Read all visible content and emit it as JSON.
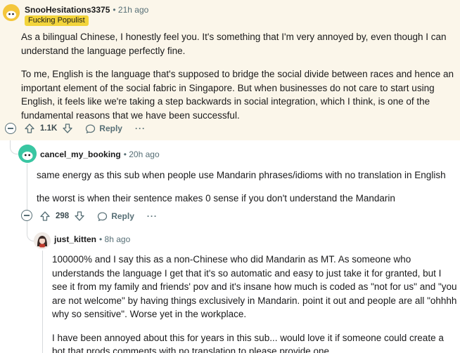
{
  "comments": [
    {
      "username": "SnooHesitations3375",
      "time": "• 21h ago",
      "flair": "Fucking Populist",
      "paragraphs": [
        "As a bilingual Chinese, I honestly feel you. It's something that I'm very annoyed by, even though I can understand the language perfectly fine.",
        "To me, English is the language that's supposed to bridge the social divide between races and hence an important element of the social fabric in Singapore. But when businesses do not care to start using English, it feels like we're taking a step backwards in social integration, which I think, is one of the fundamental reasons that we have been successful."
      ],
      "votes": "1.1K",
      "reply_label": "Reply",
      "more_label": "···"
    },
    {
      "username": "cancel_my_booking",
      "time": "• 20h ago",
      "paragraphs": [
        "same energy as this sub when people use Mandarin phrases/idioms with no translation in English",
        "the worst is when their sentence makes 0 sense if you don't understand the Mandarin"
      ],
      "votes": "298",
      "reply_label": "Reply",
      "more_label": "···"
    },
    {
      "username": "just_kitten",
      "time": "• 8h ago",
      "paragraphs": [
        "100000% and I say this as a non-Chinese who did Mandarin as MT. As someone who understands the language I get that it's so automatic and easy to just take it for granted, but I see it from my family and friends' pov and it's insane how much is coded as \"not for us\" and \"you are not welcome\" by having things exclusively in Mandarin. point it out and people are all \"ohhhh why so sensitive\". Worse yet in the workplace.",
        "I have been annoyed about this for years in this sub... would love it if someone could create a bot that prods comments with no translation to please provide one"
      ]
    }
  ],
  "icons": {
    "collapse": "collapse-icon",
    "upvote": "upvote-icon",
    "downvote": "downvote-icon",
    "reply": "reply-icon",
    "more": "more-icon",
    "avatar": "snoo-avatar"
  },
  "colors": {
    "highlight_bg": "#fbf6ea",
    "flair_bg": "#f2d43b",
    "meta_text": "#576f76",
    "avatar_1": "#f4c63b",
    "avatar_2": "#39c6a2"
  }
}
